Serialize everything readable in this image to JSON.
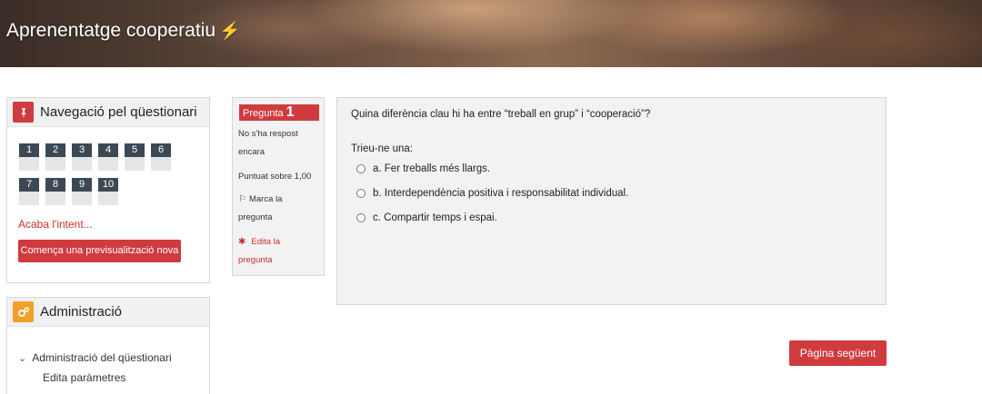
{
  "header": {
    "title": "Aprenentatge cooperatiu",
    "title_icon": "⚡"
  },
  "nav_block": {
    "title": "Navegació pel qüestionari",
    "icon": "pin-icon",
    "accent": "#d03b3f",
    "questions": [
      "1",
      "2",
      "3",
      "4",
      "5",
      "6",
      "7",
      "8",
      "9",
      "10"
    ],
    "finish_link": "Acaba l'intent...",
    "preview_button": "Comença una previsualització nova"
  },
  "admin_block": {
    "title": "Administració",
    "icon": "cogs-icon",
    "accent": "#f0a02a",
    "tree_root": "Administració del qüestionari",
    "tree_child_1": "Edita paràmetres"
  },
  "question_info": {
    "label": "Pregunta",
    "number": "1",
    "status_1": "No s'ha respost",
    "status_2": "encara",
    "marks": "Puntuat sobre 1,00",
    "flag_1": "Marca la",
    "flag_2": "pregunta",
    "edit_1": "Edita la",
    "edit_2": "pregunta"
  },
  "question": {
    "text": "Quina diferència clau hi ha entre “treball en grup” i “cooperació”?",
    "prompt": "Trieu-ne una:",
    "answers": [
      "a. Fer treballs més llargs.",
      "b. Interdependència positiva i responsabilitat individual.",
      "c. Compartir temps i espai."
    ]
  },
  "next_button": "Pàgina següent"
}
